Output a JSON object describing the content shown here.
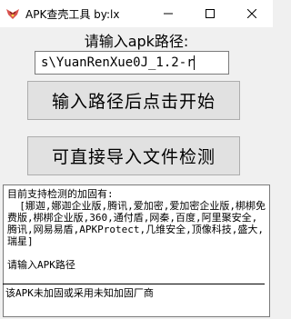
{
  "window": {
    "title": "APK查壳工具 by:lx",
    "icon": "app-logo-icon",
    "controls": [
      "minimize-icon",
      "maximize-icon",
      "close-icon"
    ]
  },
  "main": {
    "prompt_label": "请输入apk路径:",
    "path_input_value": "s\\YuanRenXue0J_1.2-r",
    "start_button_label": "输入路径后点击开始",
    "import_button_label": "可直接导入文件检测"
  },
  "log": {
    "info_text": "目前支持检测的加固有:\n  [娜迦,娜迦企业版,腾讯,爱加密,爱加密企业版,梆梆免费版,梆梆企业版,360,通付盾,网秦,百度,阿里聚安全,腾讯,网易易盾,APKProtect,几维安全,顶像科技,盛大,瑞星]\n\n请输入APK路径",
    "result_text": "该APK未加固或采用未知加固厂商"
  }
}
